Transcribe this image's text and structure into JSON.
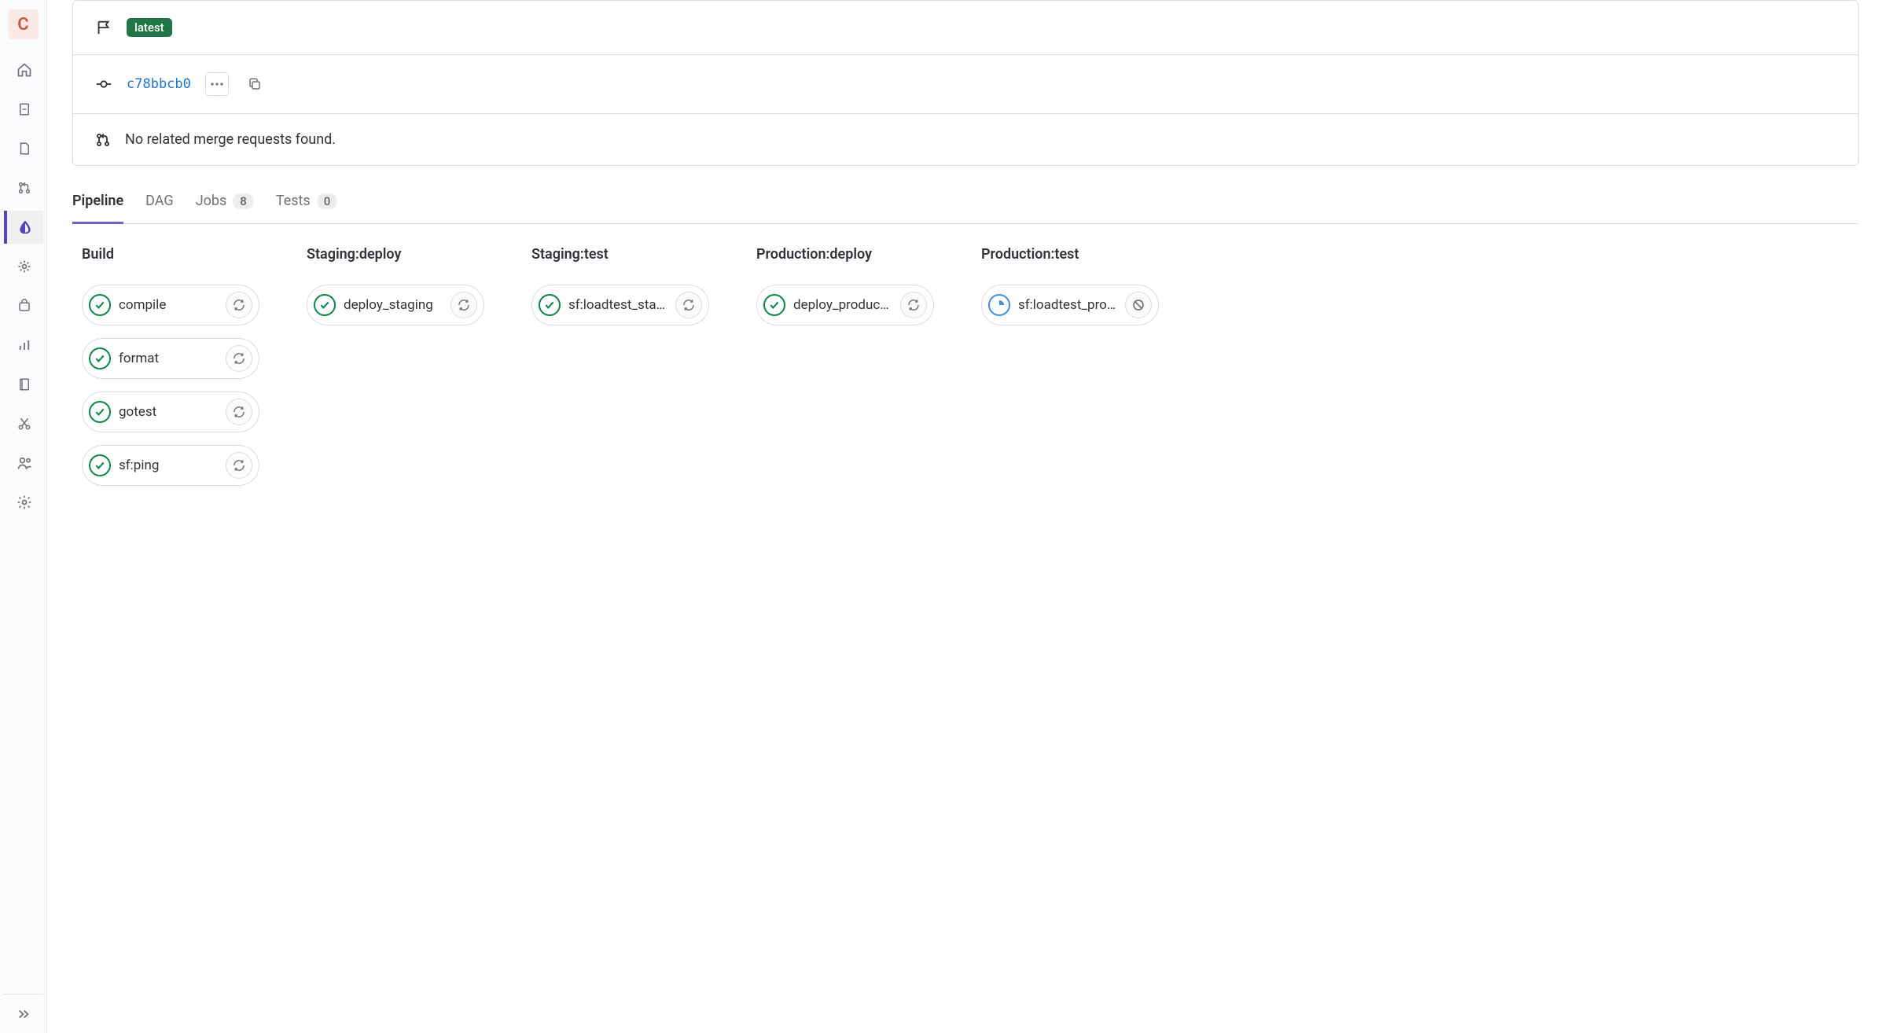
{
  "sidebar": {
    "project_letter": "C"
  },
  "header": {
    "badge_latest": "latest",
    "commit_sha": "c78bbcb0",
    "mr_text": "No related merge requests found."
  },
  "tabs": {
    "pipeline": "Pipeline",
    "dag": "DAG",
    "jobs": "Jobs",
    "jobs_count": "8",
    "tests": "Tests",
    "tests_count": "0"
  },
  "stages": {
    "build": {
      "title": "Build",
      "jobs": [
        "compile",
        "format",
        "gotest",
        "sf:ping"
      ]
    },
    "staging_deploy": {
      "title": "Staging:deploy",
      "jobs": [
        "deploy_staging"
      ]
    },
    "staging_test": {
      "title": "Staging:test",
      "jobs": [
        "sf:loadtest_sta…"
      ]
    },
    "production_deploy": {
      "title": "Production:deploy",
      "jobs": [
        "deploy_product…"
      ]
    },
    "production_test": {
      "title": "Production:test",
      "jobs": [
        "sf:loadtest_pro…"
      ]
    }
  }
}
